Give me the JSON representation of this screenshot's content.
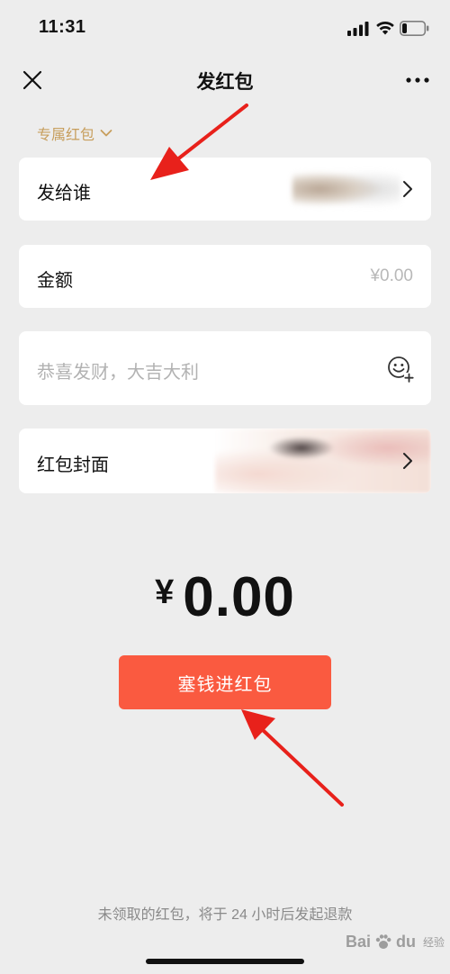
{
  "status_bar": {
    "time": "11:31",
    "icons": [
      "signal-icon",
      "wifi-icon",
      "battery-icon"
    ]
  },
  "nav": {
    "title": "发红包",
    "close_icon": "close-icon",
    "more_icon": "more-icon"
  },
  "packet_type": {
    "label": "专属红包",
    "icon": "chevron-down-icon"
  },
  "form": {
    "recipient_label": "发给谁",
    "amount_label": "金额",
    "amount_value": "¥0.00",
    "greeting_placeholder": "恭喜发财，大吉大利",
    "cover_label": "红包封面"
  },
  "total": {
    "currency": "¥",
    "amount": "0.00"
  },
  "submit_label": "塞钱进红包",
  "footer_note": "未领取的红包，将于 24 小时后发起退款",
  "watermark": {
    "brand": "Bai",
    "brand_suffix": "du",
    "sub": "经验"
  },
  "colors": {
    "accent": "#fa5a40",
    "gold": "#c79e5c",
    "background": "#ededed",
    "annotation_arrow": "#e8211b"
  }
}
